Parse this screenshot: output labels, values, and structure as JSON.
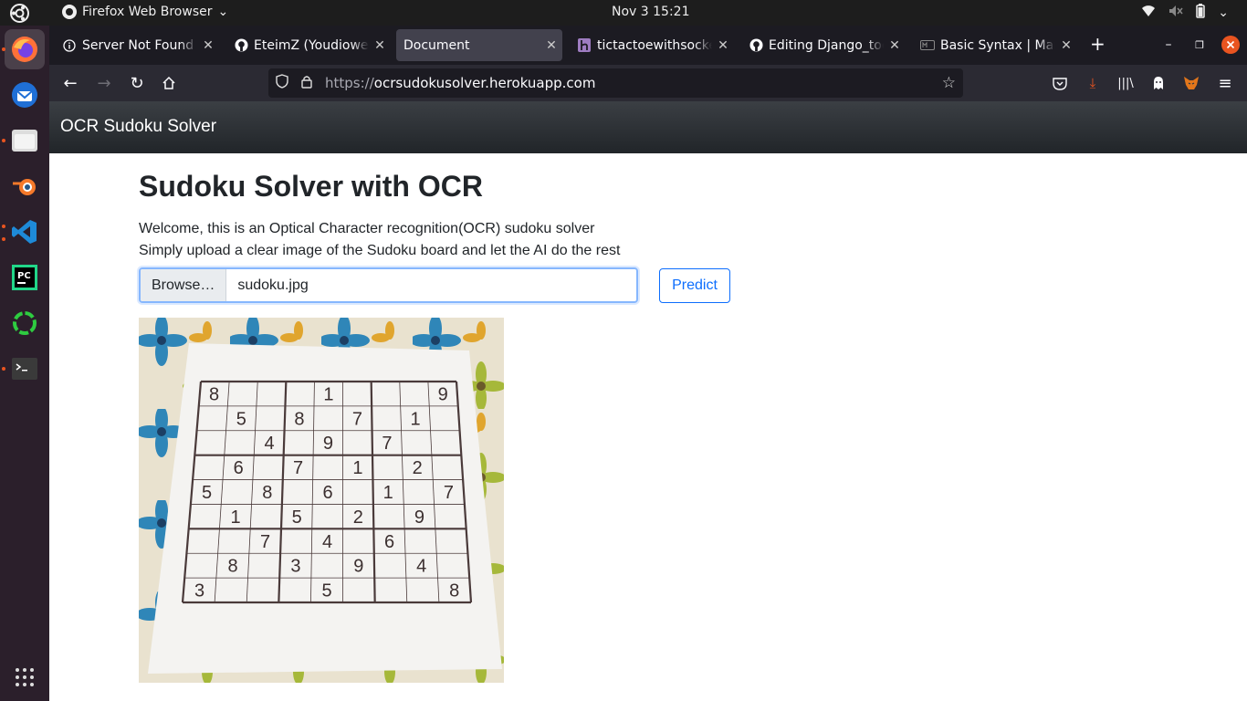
{
  "system": {
    "app_name": "Firefox Web Browser",
    "clock": "Nov 3  15:21"
  },
  "tabs": [
    {
      "label": "Server Not Found",
      "icon": "info-icon"
    },
    {
      "label": "EteimZ (Youdiowei Eteimorde)",
      "icon": "github-icon"
    },
    {
      "label": "Document",
      "icon": "none",
      "active": true
    },
    {
      "label": "tictactoewithsockets",
      "icon": "heroku-icon"
    },
    {
      "label": "Editing Django_todo",
      "icon": "github-icon"
    },
    {
      "label": "Basic Syntax | Markdown",
      "icon": "markdown-icon"
    }
  ],
  "urlbar": {
    "protocol": "https://",
    "host": "ocrsudokusolver.herokuapp.com"
  },
  "page": {
    "navbar_brand": "OCR Sudoku Solver",
    "heading": "Sudoku Solver with OCR",
    "intro_line1": "Welcome, this is an Optical Character recognition(OCR) sudoku solver",
    "intro_line2": "Simply upload a clear image of the Sudoku board and let the AI do the rest",
    "browse_label": "Browse…",
    "file_name": "sudoku.jpg",
    "predict_label": "Predict"
  },
  "sudoku": {
    "rows": [
      [
        "8",
        "",
        "",
        "",
        "1",
        "",
        "",
        "",
        "9"
      ],
      [
        "",
        "5",
        "",
        "8",
        "",
        "7",
        "",
        "1",
        ""
      ],
      [
        "",
        "",
        "4",
        "",
        "9",
        "",
        "7",
        "",
        ""
      ],
      [
        "",
        "6",
        "",
        "7",
        "",
        "1",
        "",
        "2",
        ""
      ],
      [
        "5",
        "",
        "8",
        "",
        "6",
        "",
        "1",
        "",
        "7"
      ],
      [
        "",
        "1",
        "",
        "5",
        "",
        "2",
        "",
        "9",
        ""
      ],
      [
        "",
        "",
        "7",
        "",
        "4",
        "",
        "6",
        "",
        ""
      ],
      [
        "",
        "8",
        "",
        "3",
        "",
        "9",
        "",
        "4",
        ""
      ],
      [
        "3",
        "",
        "",
        "",
        "5",
        "",
        "",
        "",
        "8"
      ]
    ]
  },
  "colors": {
    "firefox_dark": "#1c1b22",
    "bootstrap_primary": "#0d6efd",
    "ubuntu_orange": "#e95420"
  }
}
